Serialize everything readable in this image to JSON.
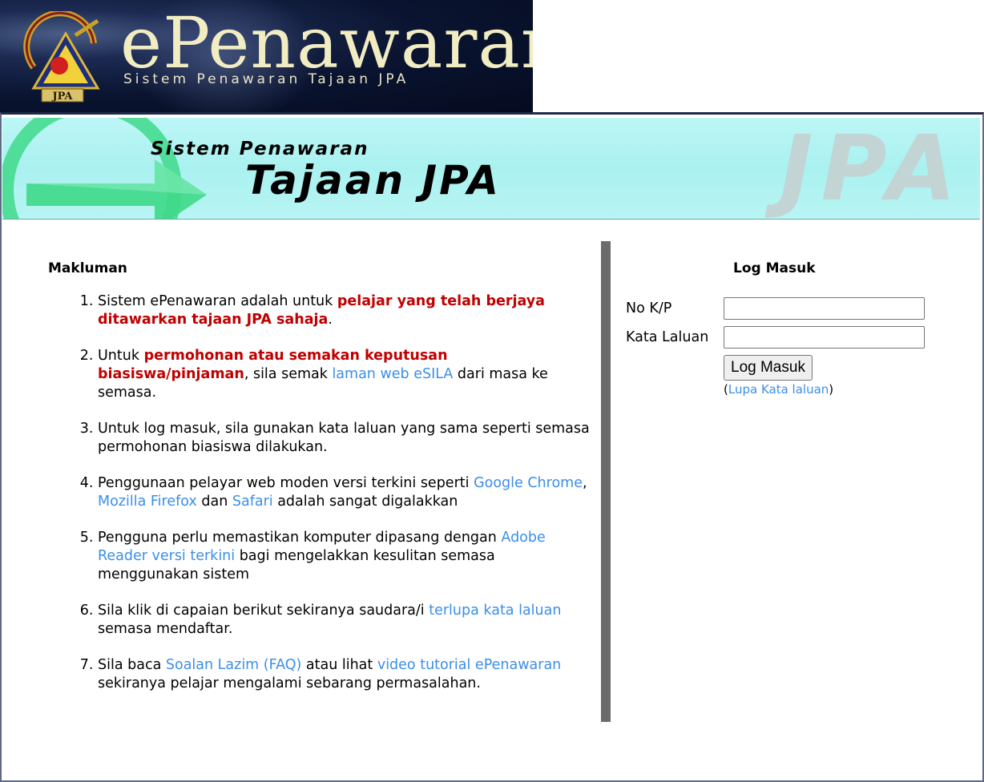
{
  "logo": {
    "title": "ePenawaran",
    "subtitle": "Sistem Penawaran Tajaan JPA",
    "emblem_text": "JPA"
  },
  "banner": {
    "line1": "Sistem Penawaran",
    "line2": "Tajaan JPA",
    "watermark": "JPA"
  },
  "info": {
    "heading": "Makluman",
    "items": [
      {
        "t1": "Sistem ePenawaran adalah untuk ",
        "emph": "pelajar yang telah berjaya ditawarkan tajaan JPA sahaja",
        "t2": "."
      },
      {
        "t1": "Untuk ",
        "emph": "permohonan atau semakan keputusan biasiswa/pinjaman",
        "t2": ", sila semak ",
        "link": "laman web eSILA",
        "t3": " dari masa ke semasa."
      },
      {
        "t1": "Untuk log masuk, sila gunakan kata laluan yang sama seperti semasa permohonan biasiswa dilakukan."
      },
      {
        "t1": "Penggunaan pelayar web moden versi terkini seperti ",
        "link1": "Google Chrome",
        "t2": ", ",
        "link2": "Mozilla Firefox",
        "t3": " dan ",
        "link3": "Safari",
        "t4": " adalah sangat digalakkan"
      },
      {
        "t1": "Pengguna perlu memastikan komputer dipasang dengan ",
        "link": "Adobe Reader versi terkini",
        "t2": " bagi mengelakkan kesulitan semasa menggunakan sistem"
      },
      {
        "t1": "Sila klik di capaian berikut sekiranya saudara/i ",
        "link": "terlupa kata laluan",
        "t2": " semasa mendaftar."
      },
      {
        "t1": "Sila baca ",
        "link1": "Soalan Lazim (FAQ)",
        "t2": " atau lihat ",
        "link2": "video tutorial ePenawaran",
        "t3": " sekiranya pelajar mengalami sebarang permasalahan."
      }
    ]
  },
  "login": {
    "heading": "Log Masuk",
    "nokp_label": "No K/P",
    "nokp_value": "",
    "password_label": "Kata Laluan",
    "password_value": "",
    "button_label": "Log Masuk",
    "forgot_open": "(",
    "forgot_link": "Lupa Kata laluan",
    "forgot_close": ")"
  },
  "colors": {
    "emphasis": "#c00000",
    "link": "#3b8ee8",
    "banner_bg": "#aef2f1",
    "divider": "#6b6b6b"
  },
  "icons": {
    "emblem": "jpa-emblem-icon",
    "banner_arrow": "arrow-right-circle-icon"
  }
}
